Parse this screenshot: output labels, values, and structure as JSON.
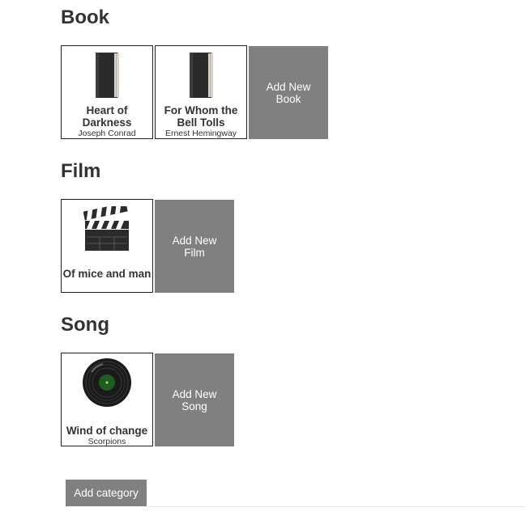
{
  "categories": [
    {
      "title": "Book",
      "items": [
        {
          "title": "Heart of Darkness",
          "subtitle": "Joseph Conrad",
          "icon": "book-icon"
        },
        {
          "title": "For Whom the Bell Tolls",
          "subtitle": "Ernest Hemingway",
          "icon": "book-icon"
        }
      ],
      "add_label": "Add New Book"
    },
    {
      "title": "Film",
      "items": [
        {
          "title": "Of mice and man",
          "subtitle": "",
          "icon": "clapperboard-icon"
        }
      ],
      "add_label": "Add New Film"
    },
    {
      "title": "Song",
      "items": [
        {
          "title": "Wind of change",
          "subtitle": "Scorpions",
          "icon": "vinyl-record-icon"
        }
      ],
      "add_label": "Add New Song"
    }
  ],
  "add_category_label": "Add category",
  "colors": {
    "tile_gray": "#808080",
    "text": "#333333",
    "card_border": "#222222"
  }
}
